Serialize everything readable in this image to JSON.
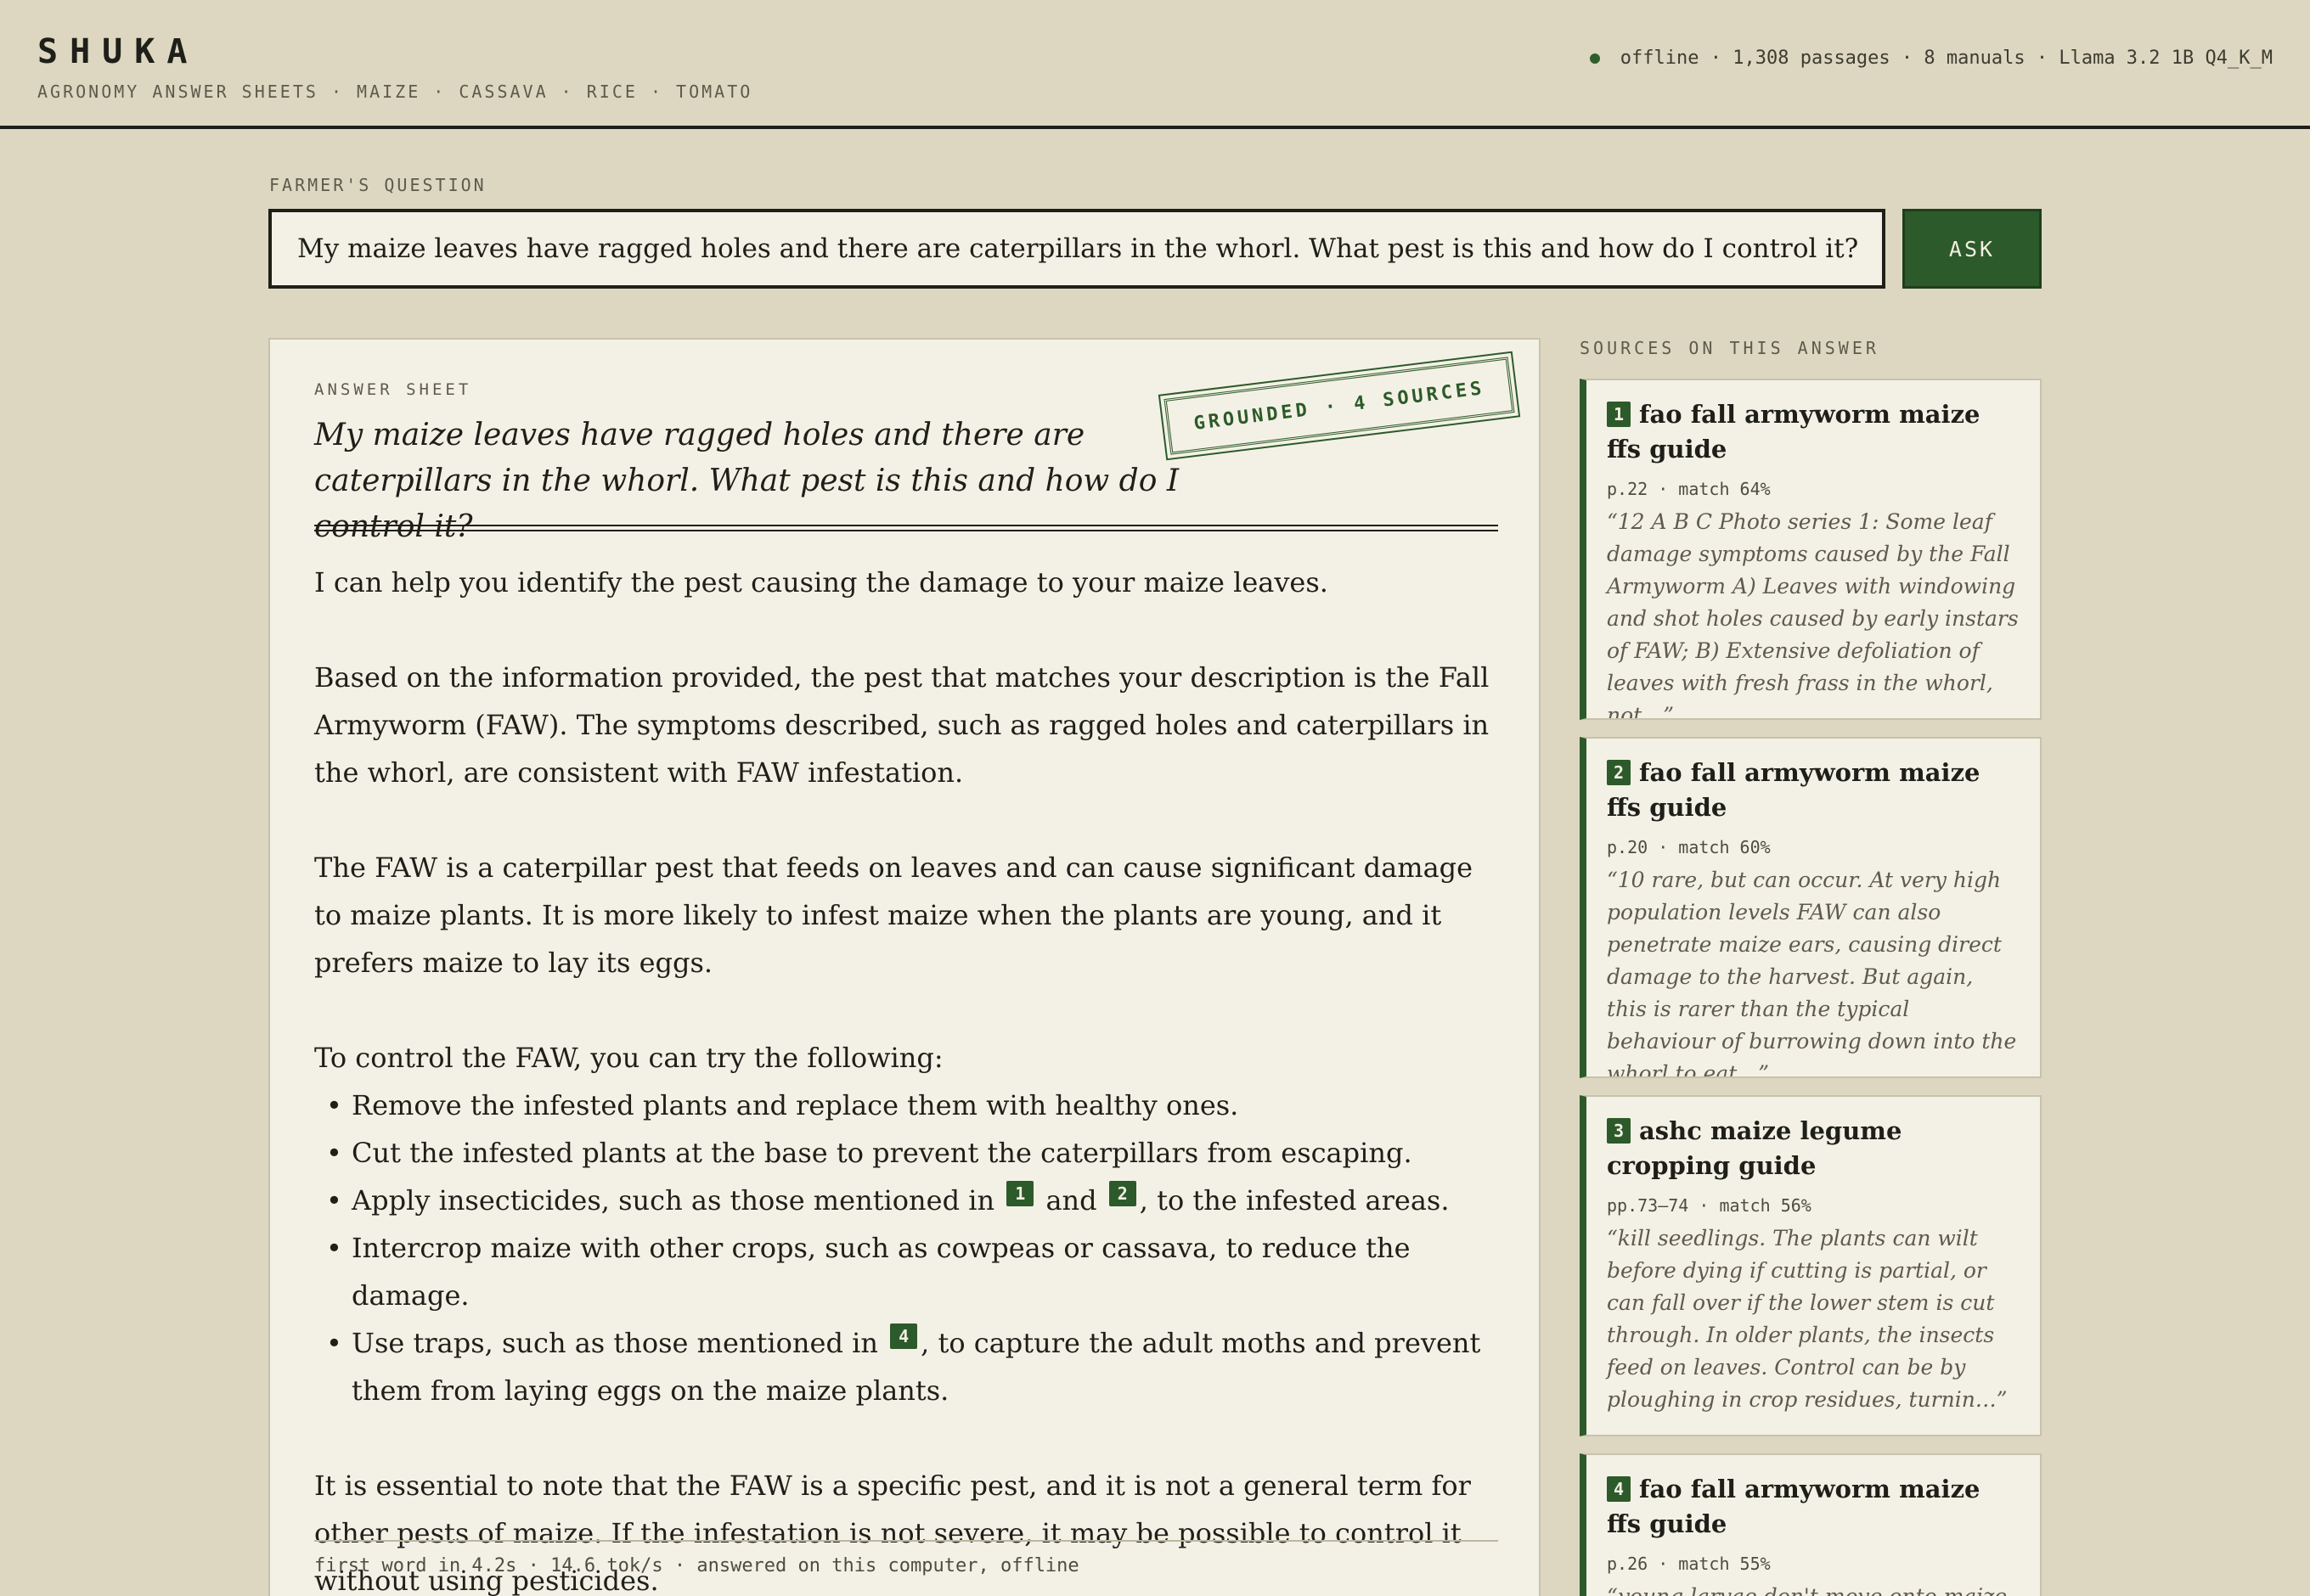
{
  "header": {
    "brand": "SHUKA",
    "tagline": "AGRONOMY ANSWER SHEETS · MAIZE · CASSAVA · RICE · TOMATO",
    "status": "offline · 1,308 passages · 8 manuals · Llama 3.2 1B Q4_K_M",
    "status_color": "#2f5e2a"
  },
  "question": {
    "label": "FARMER'S QUESTION",
    "value": "My maize leaves have ragged holes and there are caterpillars in the whorl. What pest is this and how do I control it?",
    "ask_label": "ASK"
  },
  "answer": {
    "label": "ANSWER SHEET",
    "stamp": "GROUNDED · 4 SOURCES",
    "question_echo": "My maize leaves have ragged holes and there are caterpillars in the whorl. What pest is this and how do I control it?",
    "p1": "I can help you identify the pest causing the damage to your maize leaves.",
    "p2": "Based on the information provided, the pest that matches your description is the Fall Armyworm (FAW). The symptoms described, such as ragged holes and caterpillars in the whorl, are consistent with FAW infestation.",
    "p3": "The FAW is a caterpillar pest that feeds on leaves and can cause significant damage to maize plants. It is more likely to infest maize when the plants are young, and it prefers maize to lay its eggs.",
    "p4": "To control the FAW, you can try the following:",
    "bullets": {
      "b1": "Remove the infested plants and replace them with healthy ones.",
      "b2": "Cut the infested plants at the base to prevent the caterpillars from escaping.",
      "b3a": "Apply insecticides, such as those mentioned in",
      "b3b": "and",
      "b3c": ", to the infested areas.",
      "b4": "Intercrop maize with other crops, such as cowpeas or cassava, to reduce the damage.",
      "b5a": "Use traps, such as those mentioned in",
      "b5b": ", to capture the adult moths and prevent them from laying eggs on the maize plants."
    },
    "cites": {
      "c1": "1",
      "c2": "2",
      "c4": "4"
    },
    "p5": "It is essential to note that the FAW is a specific pest, and it is not a general term for other pests of maize. If the infestation is not severe, it may be possible to control it without using pesticides.",
    "footer": "first word in 4.2s · 14.6 tok/s · answered on this computer, offline"
  },
  "sources": {
    "label": "SOURCES ON THIS ANSWER",
    "items": [
      {
        "num": "1",
        "title": "fao fall armyworm maize ffs guide",
        "meta": "p.22 · match 64%",
        "quote": "“12 A B C Photo series 1: Some leaf damage symptoms caused by the Fall Armyworm A) Leaves with windowing and shot holes caused by early instars of FAW; B) Extensive defoliation of leaves with fresh frass in the whorl, not…”"
      },
      {
        "num": "2",
        "title": "fao fall armyworm maize ffs guide",
        "meta": "p.20 · match 60%",
        "quote": "“10 rare, but can occur. At very high population levels FAW can also penetrate maize ears, causing direct damage to the harvest. But again, this is rarer than the typical behaviour of burrowing down into the whorl to eat…”"
      },
      {
        "num": "3",
        "title": "ashc maize legume cropping guide",
        "meta": "pp.73–74 · match 56%",
        "quote": "“kill seedlings. The plants can wilt before dying if cutting is partial, or can fall over if the lower stem is cut through. In older plants, the insects feed on leaves. Control can be by ploughing in crop residues, turnin…”"
      },
      {
        "num": "4",
        "title": "fao fall armyworm maize ffs guide",
        "meta": "p.26 · match 55%",
        "quote": "“young larvae don't move onto maize"
      }
    ]
  }
}
